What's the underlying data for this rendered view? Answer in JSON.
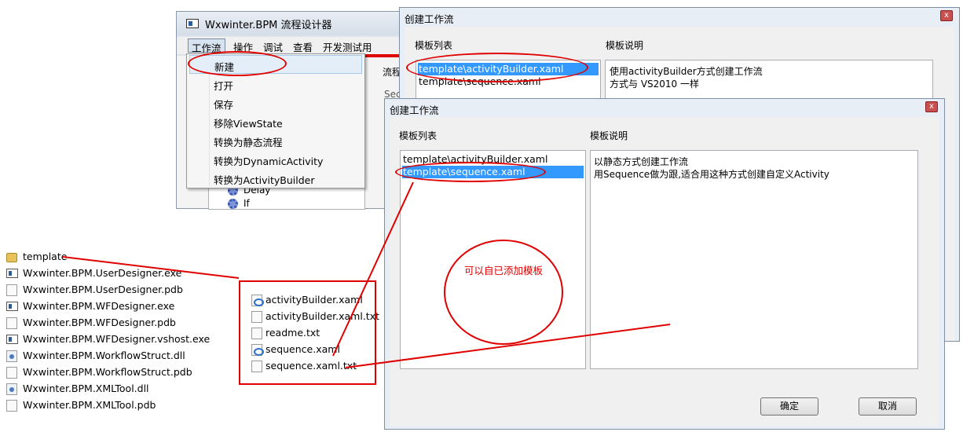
{
  "designer_window": {
    "title": "Wxwinter.BPM 流程设计器",
    "menu": [
      "工作流",
      "操作",
      "调试",
      "查看",
      "开发测试用"
    ],
    "behind_text": {
      "flow_tab": "流程",
      "sec": "Sec"
    },
    "tree_items": [
      "Delay",
      "If"
    ],
    "dropdown_items": [
      "新建",
      "打开",
      "保存",
      "移除ViewState",
      "转换为静态流程",
      "转换为DynamicActivity",
      "转换为ActivityBuilder"
    ]
  },
  "dialog_back": {
    "title": "创建工作流",
    "template_list_label": "模板列表",
    "template_desc_label": "模板说明",
    "templates": [
      "template\\activityBuilder.xaml",
      "template\\sequence.xaml"
    ],
    "selected_index": 0,
    "description_lines": [
      "使用activityBuilder方式创建工作流",
      "方式与 VS2010  一样"
    ],
    "close_label": "x"
  },
  "dialog_front": {
    "title": "创建工作流",
    "template_list_label": "模板列表",
    "template_desc_label": "模板说明",
    "templates": [
      "template\\activityBuilder.xaml",
      "template\\sequence.xaml"
    ],
    "selected_index": 1,
    "description_lines": [
      "以静态方式创建工作流",
      "用Sequence做为跟,适合用这种方式创建自定义Activity"
    ],
    "annotation": "可以自已添加模板",
    "ok_label": "确定",
    "cancel_label": "取消",
    "close_label": "x"
  },
  "file_list": [
    {
      "name": "template",
      "icon": "folder-icon"
    },
    {
      "name": "Wxwinter.BPM.UserDesigner.exe",
      "icon": "exe-icon"
    },
    {
      "name": "Wxwinter.BPM.UserDesigner.pdb",
      "icon": "file-icon"
    },
    {
      "name": "Wxwinter.BPM.WFDesigner.exe",
      "icon": "exe-icon"
    },
    {
      "name": "Wxwinter.BPM.WFDesigner.pdb",
      "icon": "file-icon"
    },
    {
      "name": "Wxwinter.BPM.WFDesigner.vshost.exe",
      "icon": "exe-icon"
    },
    {
      "name": "Wxwinter.BPM.WorkflowStruct.dll",
      "icon": "dll-icon"
    },
    {
      "name": "Wxwinter.BPM.WorkflowStruct.pdb",
      "icon": "file-icon"
    },
    {
      "name": "Wxwinter.BPM.XMLTool.dll",
      "icon": "dll-icon"
    },
    {
      "name": "Wxwinter.BPM.XMLTool.pdb",
      "icon": "file-icon"
    }
  ],
  "template_folder_files": [
    {
      "name": "activityBuilder.xaml",
      "icon": "xaml-icon"
    },
    {
      "name": "activityBuilder.xaml.txt",
      "icon": "file-icon"
    },
    {
      "name": "readme.txt",
      "icon": "file-icon"
    },
    {
      "name": "sequence.xaml",
      "icon": "xaml-icon"
    },
    {
      "name": "sequence.xaml.txt",
      "icon": "file-icon"
    }
  ],
  "colors": {
    "annotation_red": "#e00000",
    "selection_blue": "#3399ff"
  }
}
